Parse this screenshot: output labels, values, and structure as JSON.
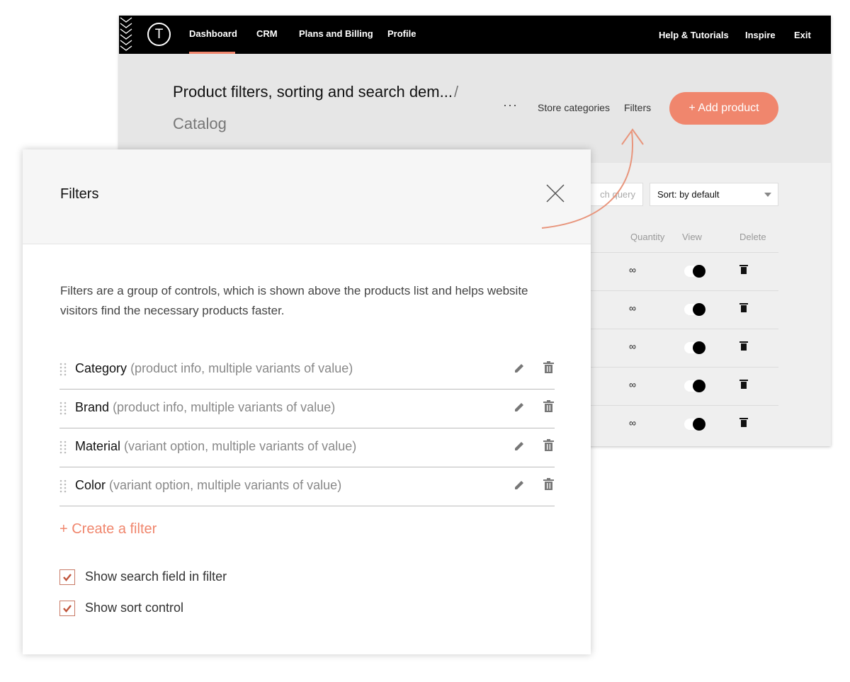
{
  "nav": {
    "logo": "T",
    "left_items": [
      "Dashboard",
      "CRM",
      "Plans and Billing",
      "Profile"
    ],
    "right_items": [
      "Help & Tutorials",
      "Inspire",
      "Exit"
    ],
    "active": "Dashboard"
  },
  "header": {
    "project_title": "Product filters, sorting and search dem...",
    "separator": "/",
    "page": "Catalog",
    "more_label": "···",
    "store_categories": "Store categories",
    "filters": "Filters",
    "add_product": "+  Add product"
  },
  "toolbar": {
    "search_placeholder": "ch query",
    "sort_value": "Sort: by default"
  },
  "table": {
    "columns": [
      "Quantity",
      "View",
      "Delete"
    ],
    "rows": [
      {
        "quantity": "∞",
        "view": true
      },
      {
        "quantity": "∞",
        "view": true
      },
      {
        "quantity": "∞",
        "view": true
      },
      {
        "quantity": "∞",
        "view": true
      },
      {
        "quantity": "∞",
        "view": true
      }
    ]
  },
  "modal": {
    "title": "Filters",
    "description": "Filters are a group of controls, which is shown above the products list and helps website visitors find the necessary products faster.",
    "filters": [
      {
        "name": "Category",
        "detail": "(product info, multiple variants of value)"
      },
      {
        "name": "Brand",
        "detail": "(product info, multiple variants of value)"
      },
      {
        "name": "Material",
        "detail": "(variant option, multiple variants of value)"
      },
      {
        "name": "Color",
        "detail": "(variant option, multiple variants of value)"
      }
    ],
    "create_filter": "+ Create a filter",
    "options": [
      {
        "label": "Show search field in filter",
        "checked": true
      },
      {
        "label": "Show sort control",
        "checked": true
      }
    ]
  },
  "colors": {
    "accent": "#f0866d",
    "topbar": "#000000",
    "header_band": "#e6e6e6"
  }
}
